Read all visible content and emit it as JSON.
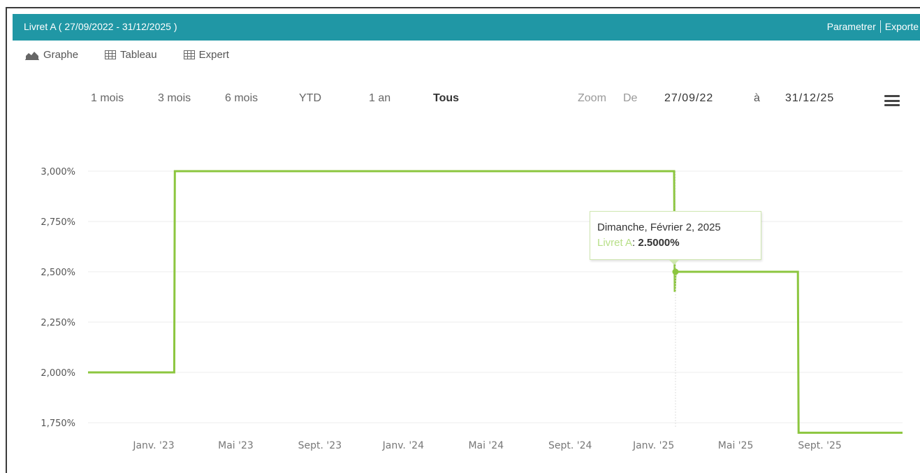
{
  "header": {
    "title": "Livret A ( 27/09/2022 - 31/12/2025 )",
    "parametrer": "Parametrer",
    "exporter": "Exporte",
    "color": "#2097a5"
  },
  "view_tabs": [
    {
      "label": "Graphe",
      "icon": "area-chart-icon"
    },
    {
      "label": "Tableau",
      "icon": "table-icon"
    },
    {
      "label": "Expert",
      "icon": "table-icon"
    }
  ],
  "range_buttons": [
    {
      "label": "1 mois"
    },
    {
      "label": "3 mois"
    },
    {
      "label": "6 mois"
    },
    {
      "label": "YTD"
    },
    {
      "label": "1 an"
    },
    {
      "label": "Tous",
      "active": true
    }
  ],
  "zoom": {
    "zoom_label": "Zoom",
    "from_label": "De",
    "from_value": "27/09/22",
    "to_label": "à",
    "to_value": "31/12/25"
  },
  "chart_data": {
    "type": "line",
    "step": true,
    "series": [
      {
        "name": "Livret A",
        "color": "#8cc63f",
        "points": [
          {
            "date": "2022-09-27",
            "value": 2.0
          },
          {
            "date": "2023-01-31",
            "value": 2.0
          },
          {
            "date": "2023-02-01",
            "value": 3.0
          },
          {
            "date": "2025-01-31",
            "value": 3.0
          },
          {
            "date": "2025-02-01",
            "value": 2.4
          },
          {
            "date": "2025-02-02",
            "value": 2.5
          },
          {
            "date": "2025-07-31",
            "value": 2.5
          },
          {
            "date": "2025-08-01",
            "value": 1.7
          },
          {
            "date": "2025-12-31",
            "value": 1.7
          }
        ]
      }
    ],
    "y_ticks": [
      {
        "value": 3.0,
        "label": "3,000%"
      },
      {
        "value": 2.75,
        "label": "2,750%"
      },
      {
        "value": 2.5,
        "label": "2,500%"
      },
      {
        "value": 2.25,
        "label": "2,250%"
      },
      {
        "value": 2.0,
        "label": "2,000%"
      },
      {
        "value": 1.75,
        "label": "1,750%"
      }
    ],
    "x_ticks": [
      {
        "date": "2023-01-01",
        "label": "Janv. '23"
      },
      {
        "date": "2023-05-01",
        "label": "Mai '23"
      },
      {
        "date": "2023-09-01",
        "label": "Sept. '23"
      },
      {
        "date": "2024-01-01",
        "label": "Janv. '24"
      },
      {
        "date": "2024-05-01",
        "label": "Mai '24"
      },
      {
        "date": "2024-09-01",
        "label": "Sept. '24"
      },
      {
        "date": "2025-01-01",
        "label": "Janv. '25"
      },
      {
        "date": "2025-05-01",
        "label": "Mai '25"
      },
      {
        "date": "2025-09-01",
        "label": "Sept. '25"
      }
    ],
    "x_range": [
      "2022-09-27",
      "2025-12-31"
    ],
    "grid": true,
    "tooltip": {
      "date": "2025-02-02",
      "value": 2.5,
      "title": "Dimanche, Février 2, 2025",
      "series_label": "Livret A",
      "separator": ": ",
      "value_text": "2.5000%"
    }
  }
}
